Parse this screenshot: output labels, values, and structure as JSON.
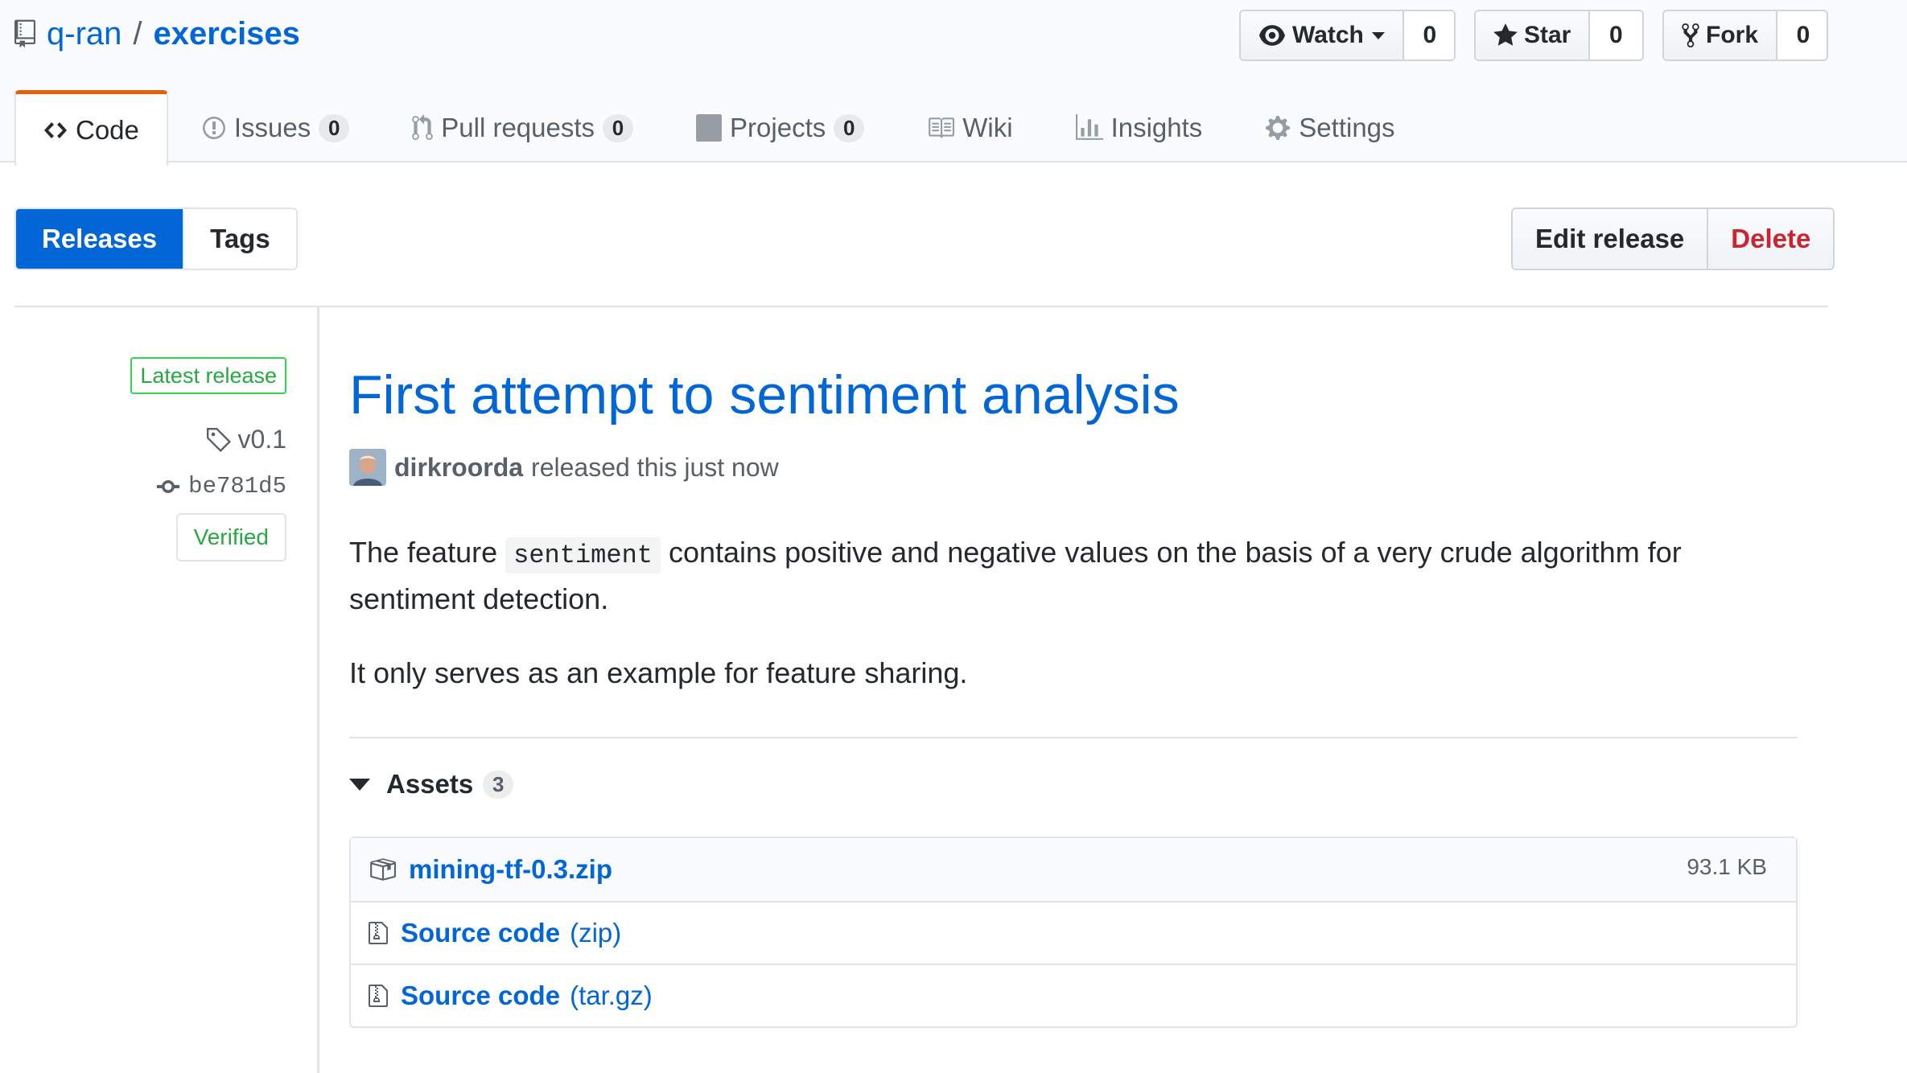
{
  "repo": {
    "owner": "q-ran",
    "separator": "/",
    "name": "exercises"
  },
  "social": {
    "watch_label": "Watch",
    "watch_count": "0",
    "star_label": "Star",
    "star_count": "0",
    "fork_label": "Fork",
    "fork_count": "0"
  },
  "nav": {
    "code": "Code",
    "issues": "Issues",
    "issues_count": "0",
    "pulls": "Pull requests",
    "pulls_count": "0",
    "projects": "Projects",
    "projects_count": "0",
    "wiki": "Wiki",
    "insights": "Insights",
    "settings": "Settings"
  },
  "subnav": {
    "releases": "Releases",
    "tags": "Tags"
  },
  "actions": {
    "edit": "Edit release",
    "delete": "Delete"
  },
  "meta": {
    "latest_label": "Latest release",
    "tag": "v0.1",
    "commit": "be781d5",
    "verified": "Verified"
  },
  "release": {
    "title": "First attempt to sentiment analysis",
    "author": "dirkroorda",
    "released_text": "released this just now",
    "body_p1_before": "The feature",
    "body_p1_code": "sentiment",
    "body_p1_after": "contains positive and negative values on the basis of a very crude algorithm for sentiment detection.",
    "body_p2": "It only serves as an example for feature sharing."
  },
  "assets": {
    "label": "Assets",
    "count": "3",
    "items": [
      {
        "name": "mining-tf-0.3.zip",
        "ext": "",
        "size": "93.1 KB"
      },
      {
        "name": "Source code",
        "ext": "(zip)",
        "size": ""
      },
      {
        "name": "Source code",
        "ext": "(tar.gz)",
        "size": ""
      }
    ]
  },
  "colors": {
    "link": "#0366d6",
    "nav_accent": "#e36209",
    "delete": "#cb2431",
    "verified": "#28a745"
  },
  "icons": [
    "repo-icon",
    "eye-icon",
    "star-icon",
    "fork-icon",
    "code-icon",
    "issue-icon",
    "pull-request-icon",
    "project-icon",
    "wiki-icon",
    "graph-icon",
    "gear-icon",
    "tag-icon",
    "commit-icon",
    "package-icon",
    "file-zip-icon"
  ]
}
